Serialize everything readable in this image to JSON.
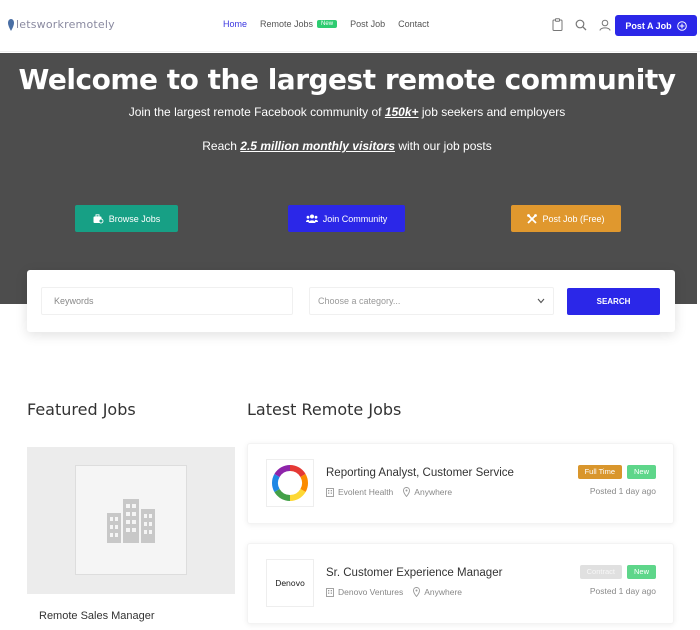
{
  "header": {
    "logo_text": "letsworkremotely",
    "nav": [
      {
        "label": "Home"
      },
      {
        "label": "Remote Jobs",
        "badge": "New"
      },
      {
        "label": "Post Job"
      },
      {
        "label": "Contact"
      }
    ],
    "post_job_label": "Post A Job"
  },
  "hero": {
    "title": "Welcome to the largest remote community",
    "sub1_pre": "Join the largest remote Facebook community of ",
    "sub1_highlight": "150k+",
    "sub1_post": " job seekers and employers",
    "sub2_pre": "Reach ",
    "sub2_highlight": "2.5 million monthly visitors",
    "sub2_post": " with our job posts",
    "buttons": {
      "browse": "Browse Jobs",
      "join": "Join Community",
      "post_free": "Post Job (Free)"
    }
  },
  "search": {
    "keywords_placeholder": "Keywords",
    "category_placeholder": "Choose a category...",
    "button_label": "SEARCH"
  },
  "featured": {
    "section_title": "Featured Jobs",
    "job_title": "Remote Sales Manager"
  },
  "latest": {
    "section_title": "Latest Remote Jobs",
    "jobs": [
      {
        "title": "Reporting Analyst, Customer Service",
        "company": "Evolent Health",
        "location": "Anywhere",
        "type": "Full Time",
        "badge": "New",
        "posted": "Posted 1 day ago"
      },
      {
        "title": "Sr. Customer Experience Manager",
        "company": "Denovo Ventures",
        "location": "Anywhere",
        "type": "Contract",
        "badge": "New",
        "posted": "Posted 1 day ago",
        "logo_text": "Denovo"
      }
    ]
  },
  "colors": {
    "primary": "#2b27e8",
    "teal": "#17a085",
    "orange": "#e0982e",
    "green": "#5ed68a",
    "hero_bg": "#4d4d4d"
  }
}
